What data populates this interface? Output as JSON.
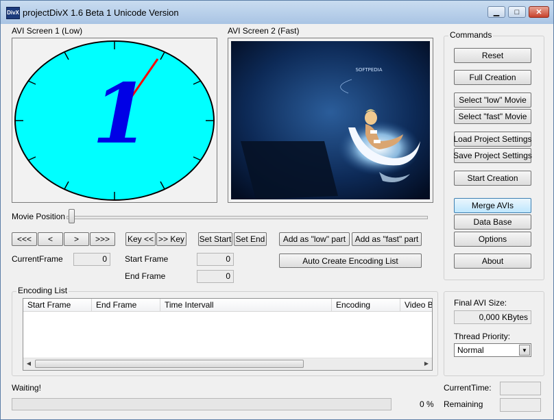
{
  "window": {
    "title": "projectDivX 1.6 Beta 1 Unicode Version",
    "icon_text": "DivX"
  },
  "screens": {
    "screen1_label": "AVI Screen 1 (Low)",
    "screen2_label": "AVI Screen 2 (Fast)",
    "clock_digit": "1",
    "watermark": "SOFTPEDIA"
  },
  "movie_position": {
    "label": "Movie Position",
    "value": 0
  },
  "nav_buttons": [
    "<<<",
    "<",
    ">",
    ">>>"
  ],
  "key_buttons": [
    "Key <<",
    ">> Key"
  ],
  "set_buttons": [
    "Set Start",
    "Set End"
  ],
  "part_buttons": {
    "low": "Add as \"low\" part",
    "fast": "Add as \"fast\" part"
  },
  "frames": {
    "current_label": "CurrentFrame",
    "current_value": "0",
    "start_label": "Start Frame",
    "start_value": "0",
    "end_label": "End Frame",
    "end_value": "0"
  },
  "auto_create_button": "Auto Create Encoding List",
  "commands": {
    "title": "Commands",
    "reset": "Reset",
    "full_creation": "Full Creation",
    "select_low": "Select \"low\" Movie",
    "select_fast": "Select \"fast\" Movie",
    "load_settings": "Load Project Settings",
    "save_settings": "Save Project Settings",
    "start_creation": "Start Creation",
    "merge_avis": "Merge AVIs",
    "data_base": "Data Base",
    "options": "Options",
    "about": "About"
  },
  "encoding_list": {
    "title": "Encoding List",
    "columns": [
      "Start Frame",
      "End Frame",
      "Time Intervall",
      "Encoding",
      "Video Bu"
    ]
  },
  "final_avi": {
    "label": "Final AVI Size:",
    "value": "0,000 KBytes"
  },
  "thread_priority": {
    "label": "Thread Priority:",
    "value": "Normal"
  },
  "status": {
    "text": "Waiting!",
    "progress_label": "0 %",
    "progress_fraction": 0,
    "current_time_label": "CurrentTime:",
    "remaining_label": "Remaining"
  },
  "colors": {
    "clock_face": "#00ffff",
    "clock_hand": "#ff0000",
    "digit": "#0000e6",
    "progress": "#06b025"
  }
}
